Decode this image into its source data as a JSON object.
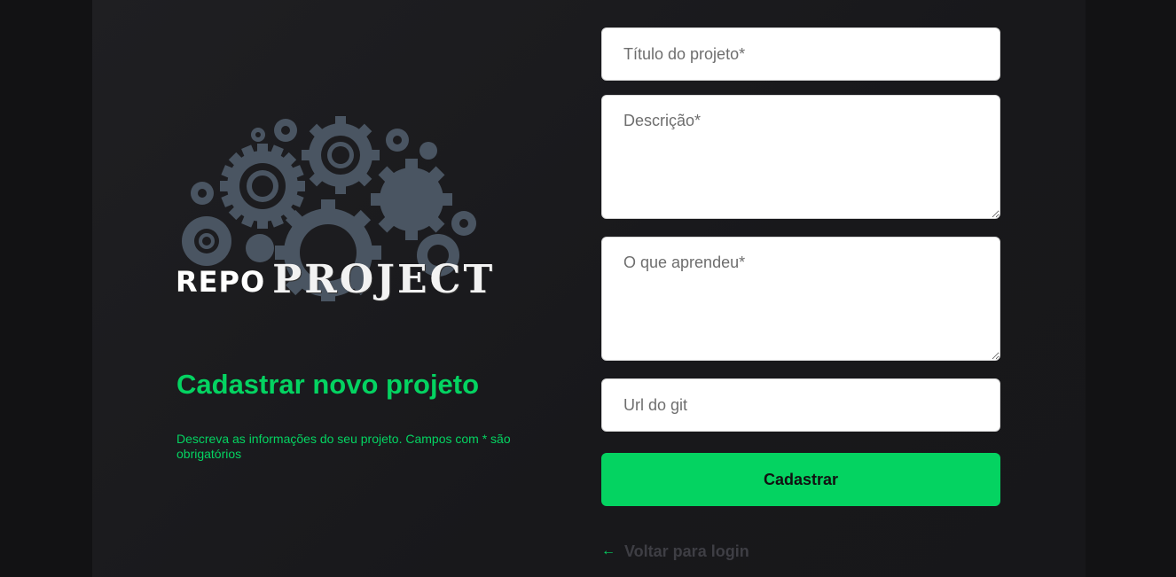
{
  "brand": {
    "logo_part1": "REPO",
    "logo_part2": "PROJECT",
    "gear_color": "#4a5562"
  },
  "page": {
    "title": "Cadastrar novo projeto",
    "subtitle": "Descreva as informações do seu projeto. Campos com * são obrigatórios"
  },
  "form": {
    "title_placeholder": "Título do projeto*",
    "description_placeholder": "Descrição*",
    "learned_placeholder": "O que aprendeu*",
    "git_placeholder": "Url do git",
    "submit_label": "Cadastrar"
  },
  "back": {
    "icon": "arrow-left-icon",
    "label": "Voltar para login"
  },
  "colors": {
    "accent": "#04d361",
    "background": "#121214"
  }
}
